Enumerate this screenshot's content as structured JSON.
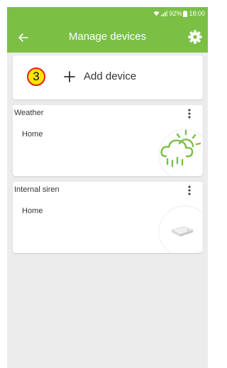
{
  "status_bar": {
    "battery": "92%",
    "time": "18:00"
  },
  "header": {
    "title": "Manage devices",
    "back_icon": "back-arrow-icon",
    "settings_icon": "gear-icon"
  },
  "add_device": {
    "step_number": "3",
    "label": "Add device",
    "icon": "plus-icon"
  },
  "devices": [
    {
      "name": "Weather",
      "location": "Home",
      "icon": "weather-cloud-rain-icon"
    },
    {
      "name": "Internal siren",
      "location": "Home",
      "icon": "siren-device-icon"
    }
  ],
  "colors": {
    "accent": "#7bbf45",
    "background": "#ececec",
    "weather_icon": "#7bbf45",
    "badge_fill": "#f7e600",
    "badge_border": "#e41f1f"
  }
}
